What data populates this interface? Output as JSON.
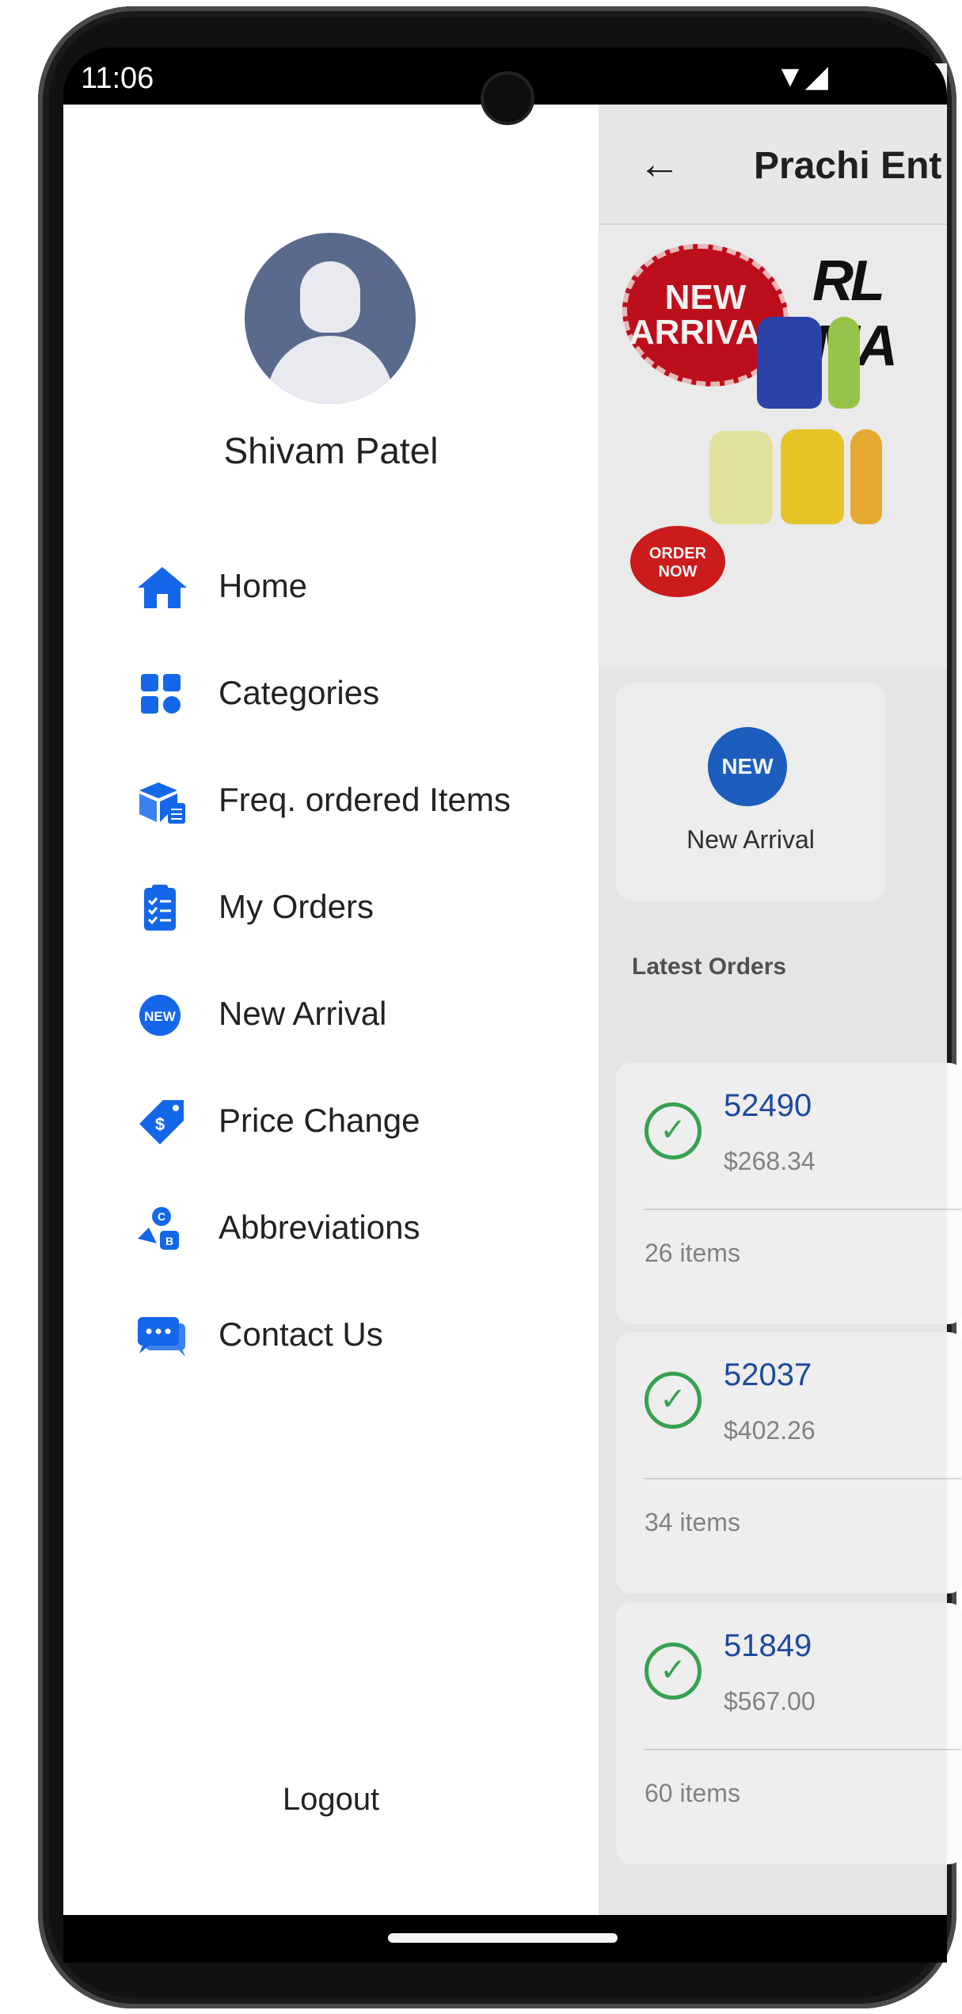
{
  "status_bar": {
    "time": "11:06",
    "signal_icons": "▼◢"
  },
  "background_app": {
    "title": "Prachi Ent",
    "banner": {
      "badge_new": "NEW ARRIVAL",
      "badge_order": "ORDER NOW",
      "brand_partial": "RL MA"
    },
    "nav_card": {
      "icon_text": "NEW",
      "label": "New Arrival"
    },
    "latest_orders_title": "Latest Orders",
    "orders": [
      {
        "number": "52490",
        "amount": "$268.34",
        "items": "26 items"
      },
      {
        "number": "52037",
        "amount": "$402.26",
        "items": "34 items"
      },
      {
        "number": "51849",
        "amount": "$567.00",
        "items": "60 items"
      }
    ]
  },
  "drawer": {
    "user_name": "Shivam Patel",
    "menu": [
      {
        "label": "Home",
        "icon": "home-icon"
      },
      {
        "label": "Categories",
        "icon": "categories-icon"
      },
      {
        "label": "Freq. ordered Items",
        "icon": "freq-items-icon"
      },
      {
        "label": "My Orders",
        "icon": "orders-icon"
      },
      {
        "label": "New Arrival",
        "icon": "new-badge-icon"
      },
      {
        "label": "Price Change",
        "icon": "price-tag-icon"
      },
      {
        "label": "Abbreviations",
        "icon": "abbreviations-icon"
      },
      {
        "label": "Contact Us",
        "icon": "chat-icon"
      }
    ],
    "logout_label": "Logout"
  },
  "colors": {
    "accent": "#1467e8",
    "order_number": "#1f4ea6",
    "check": "#3aaa55"
  }
}
